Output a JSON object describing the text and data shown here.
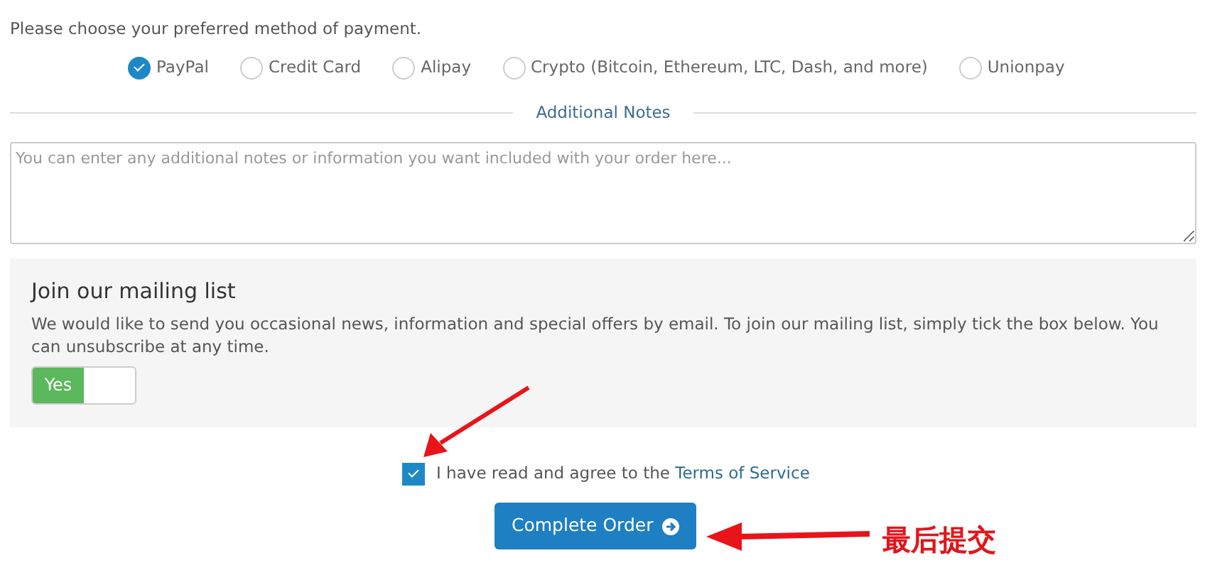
{
  "payment": {
    "prompt": "Please choose your preferred method of payment.",
    "options": [
      {
        "label": "PayPal",
        "selected": true
      },
      {
        "label": "Credit Card",
        "selected": false
      },
      {
        "label": "Alipay",
        "selected": false
      },
      {
        "label": "Crypto (Bitcoin, Ethereum, LTC, Dash, and more)",
        "selected": false
      },
      {
        "label": "Unionpay",
        "selected": false
      }
    ]
  },
  "notes": {
    "heading": "Additional Notes",
    "placeholder": "You can enter any additional notes or information you want included with your order here..."
  },
  "mailing": {
    "title": "Join our mailing list",
    "text": "We would like to send you occasional news, information and special offers by email. To join our mailing list, simply tick the box below. You can unsubscribe at any time.",
    "toggle": {
      "label": "Yes",
      "on": true
    }
  },
  "terms": {
    "text": "I have read and agree to the ",
    "link": "Terms of Service",
    "checked": true
  },
  "submit": {
    "label": "Complete Order"
  },
  "annotation": {
    "text": "最后提交"
  }
}
